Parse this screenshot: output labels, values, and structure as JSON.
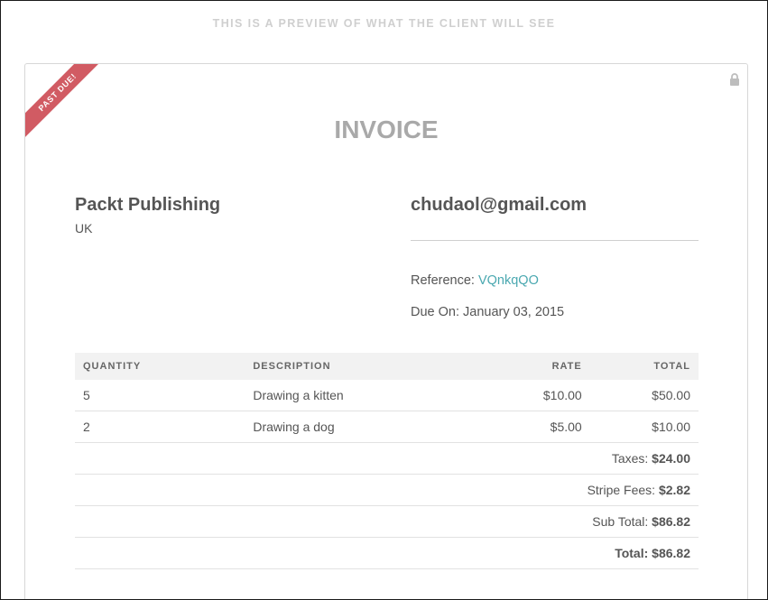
{
  "preview_banner": "THIS IS A PREVIEW OF WHAT THE CLIENT WILL SEE",
  "ribbon_label": "PAST DUE!",
  "lock_icon": "lock-icon",
  "invoice": {
    "title": "INVOICE",
    "company": {
      "name": "Packt Publishing",
      "country": "UK"
    },
    "client": {
      "email": "chudaol@gmail.com"
    },
    "reference_label": "Reference:",
    "reference_value": "VQnkqQO",
    "due_on": "Due On: January 03, 2015",
    "colors": {
      "ribbon": "#d15b63",
      "link": "#4aa8b0",
      "title": "#a9a9a9"
    }
  },
  "table": {
    "headers": {
      "quantity": "QUANTITY",
      "description": "DESCRIPTION",
      "rate": "RATE",
      "total": "TOTAL"
    },
    "rows": [
      {
        "quantity": "5",
        "description": "Drawing a kitten",
        "rate": "$10.00",
        "total": "$50.00"
      },
      {
        "quantity": "2",
        "description": "Drawing a dog",
        "rate": "$5.00",
        "total": "$10.00"
      }
    ],
    "summary": [
      {
        "label": "Taxes:",
        "value": "$24.00"
      },
      {
        "label": "Stripe Fees:",
        "value": "$2.82"
      },
      {
        "label": "Sub Total:",
        "value": "$86.82"
      },
      {
        "label": "Total:",
        "value": "$86.82"
      }
    ]
  }
}
